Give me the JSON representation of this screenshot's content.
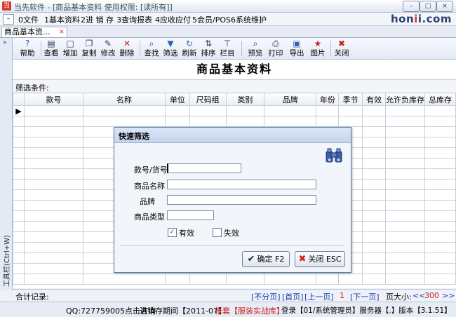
{
  "window": {
    "title": "当先软件 - [商品基本资料  使用权限: [读所有]]",
    "app_icon": "当",
    "logo_prefix": "hon",
    "logo_mid": "i",
    "logo_suffix": "i.com",
    "minimize": "–",
    "restore": "□",
    "close": "×"
  },
  "menubar": {
    "system": "–",
    "items": [
      "0文件",
      "1基本资料",
      "2进 销 存",
      "3查询报表",
      "4应收应付",
      "5会员/POS",
      "6系统维护"
    ]
  },
  "tab": {
    "label": "商品基本资...",
    "close": "×"
  },
  "sidestrip": {
    "arrow": "»",
    "label": "工具栏(Ctrl+W)"
  },
  "toolbar": {
    "buttons": [
      {
        "label": "帮助",
        "icon": "help-icon",
        "glyph": "?"
      },
      {
        "label": "查看",
        "icon": "view-icon",
        "glyph": "▤"
      },
      {
        "label": "增加",
        "icon": "add-icon",
        "glyph": "□"
      },
      {
        "label": "复制",
        "icon": "copy-icon",
        "glyph": "❐"
      },
      {
        "label": "修改",
        "icon": "edit-icon",
        "glyph": "✎"
      },
      {
        "label": "删除",
        "icon": "delete-icon",
        "glyph": "✕"
      },
      {
        "label": "查找",
        "icon": "find-icon",
        "glyph": "⌕"
      },
      {
        "label": "筛选",
        "icon": "filter-icon",
        "glyph": "▼"
      },
      {
        "label": "刷新",
        "icon": "refresh-icon",
        "glyph": "↻"
      },
      {
        "label": "排序",
        "icon": "sort-icon",
        "glyph": "⇅"
      },
      {
        "label": "栏目",
        "icon": "columns-icon",
        "glyph": "⊤"
      },
      {
        "label": "预览",
        "icon": "preview-icon",
        "glyph": "⌕"
      },
      {
        "label": "打印",
        "icon": "print-icon",
        "glyph": "⎙"
      },
      {
        "label": "导出",
        "icon": "export-icon",
        "glyph": "▣"
      },
      {
        "label": "图片",
        "icon": "picture-icon",
        "glyph": "★"
      },
      {
        "label": "关闭",
        "icon": "close-icon",
        "glyph": "✖"
      }
    ]
  },
  "page": {
    "title": "商品基本资料",
    "filter_label": "筛选条件:"
  },
  "grid": {
    "columns": [
      "款号",
      "名称",
      "单位",
      "尺码组",
      "类别",
      "品牌",
      "年份",
      "季节",
      "有效",
      "允许负库存",
      "总库存"
    ],
    "row_indicator": "▶"
  },
  "status1": {
    "total_label": "合计记录:",
    "no_page": "[不分页]",
    "first": "[首页]",
    "prev": "[上一页]",
    "page_num": "1",
    "next": "[下一页]",
    "page_size_label": "页大小:",
    "page_size_prev": "<<",
    "page_size_value": "300",
    "page_size_next": ">>"
  },
  "status2": {
    "qq": "QQ:727759005点击咨询",
    "period": "进销存期间【2011-07】",
    "account": "帐套【服装实战库】",
    "login": "登录【01/系统管理员】服务器【.】版本【3.1.51】"
  },
  "dialog": {
    "title": "快速筛选",
    "fields": {
      "code_label": "款号/货号",
      "code_value": "",
      "name_label": "商品名称",
      "name_value": "",
      "brand_label": "品牌",
      "brand_value": "",
      "type_label": "商品类型",
      "type_value": ""
    },
    "valid_label": "有效",
    "valid_checked": "✓",
    "invalid_label": "失效",
    "invalid_checked": "",
    "ok_glyph": "✔",
    "ok_label": "确定 F2",
    "close_glyph": "✖",
    "close_label": "关闭 ESC"
  }
}
